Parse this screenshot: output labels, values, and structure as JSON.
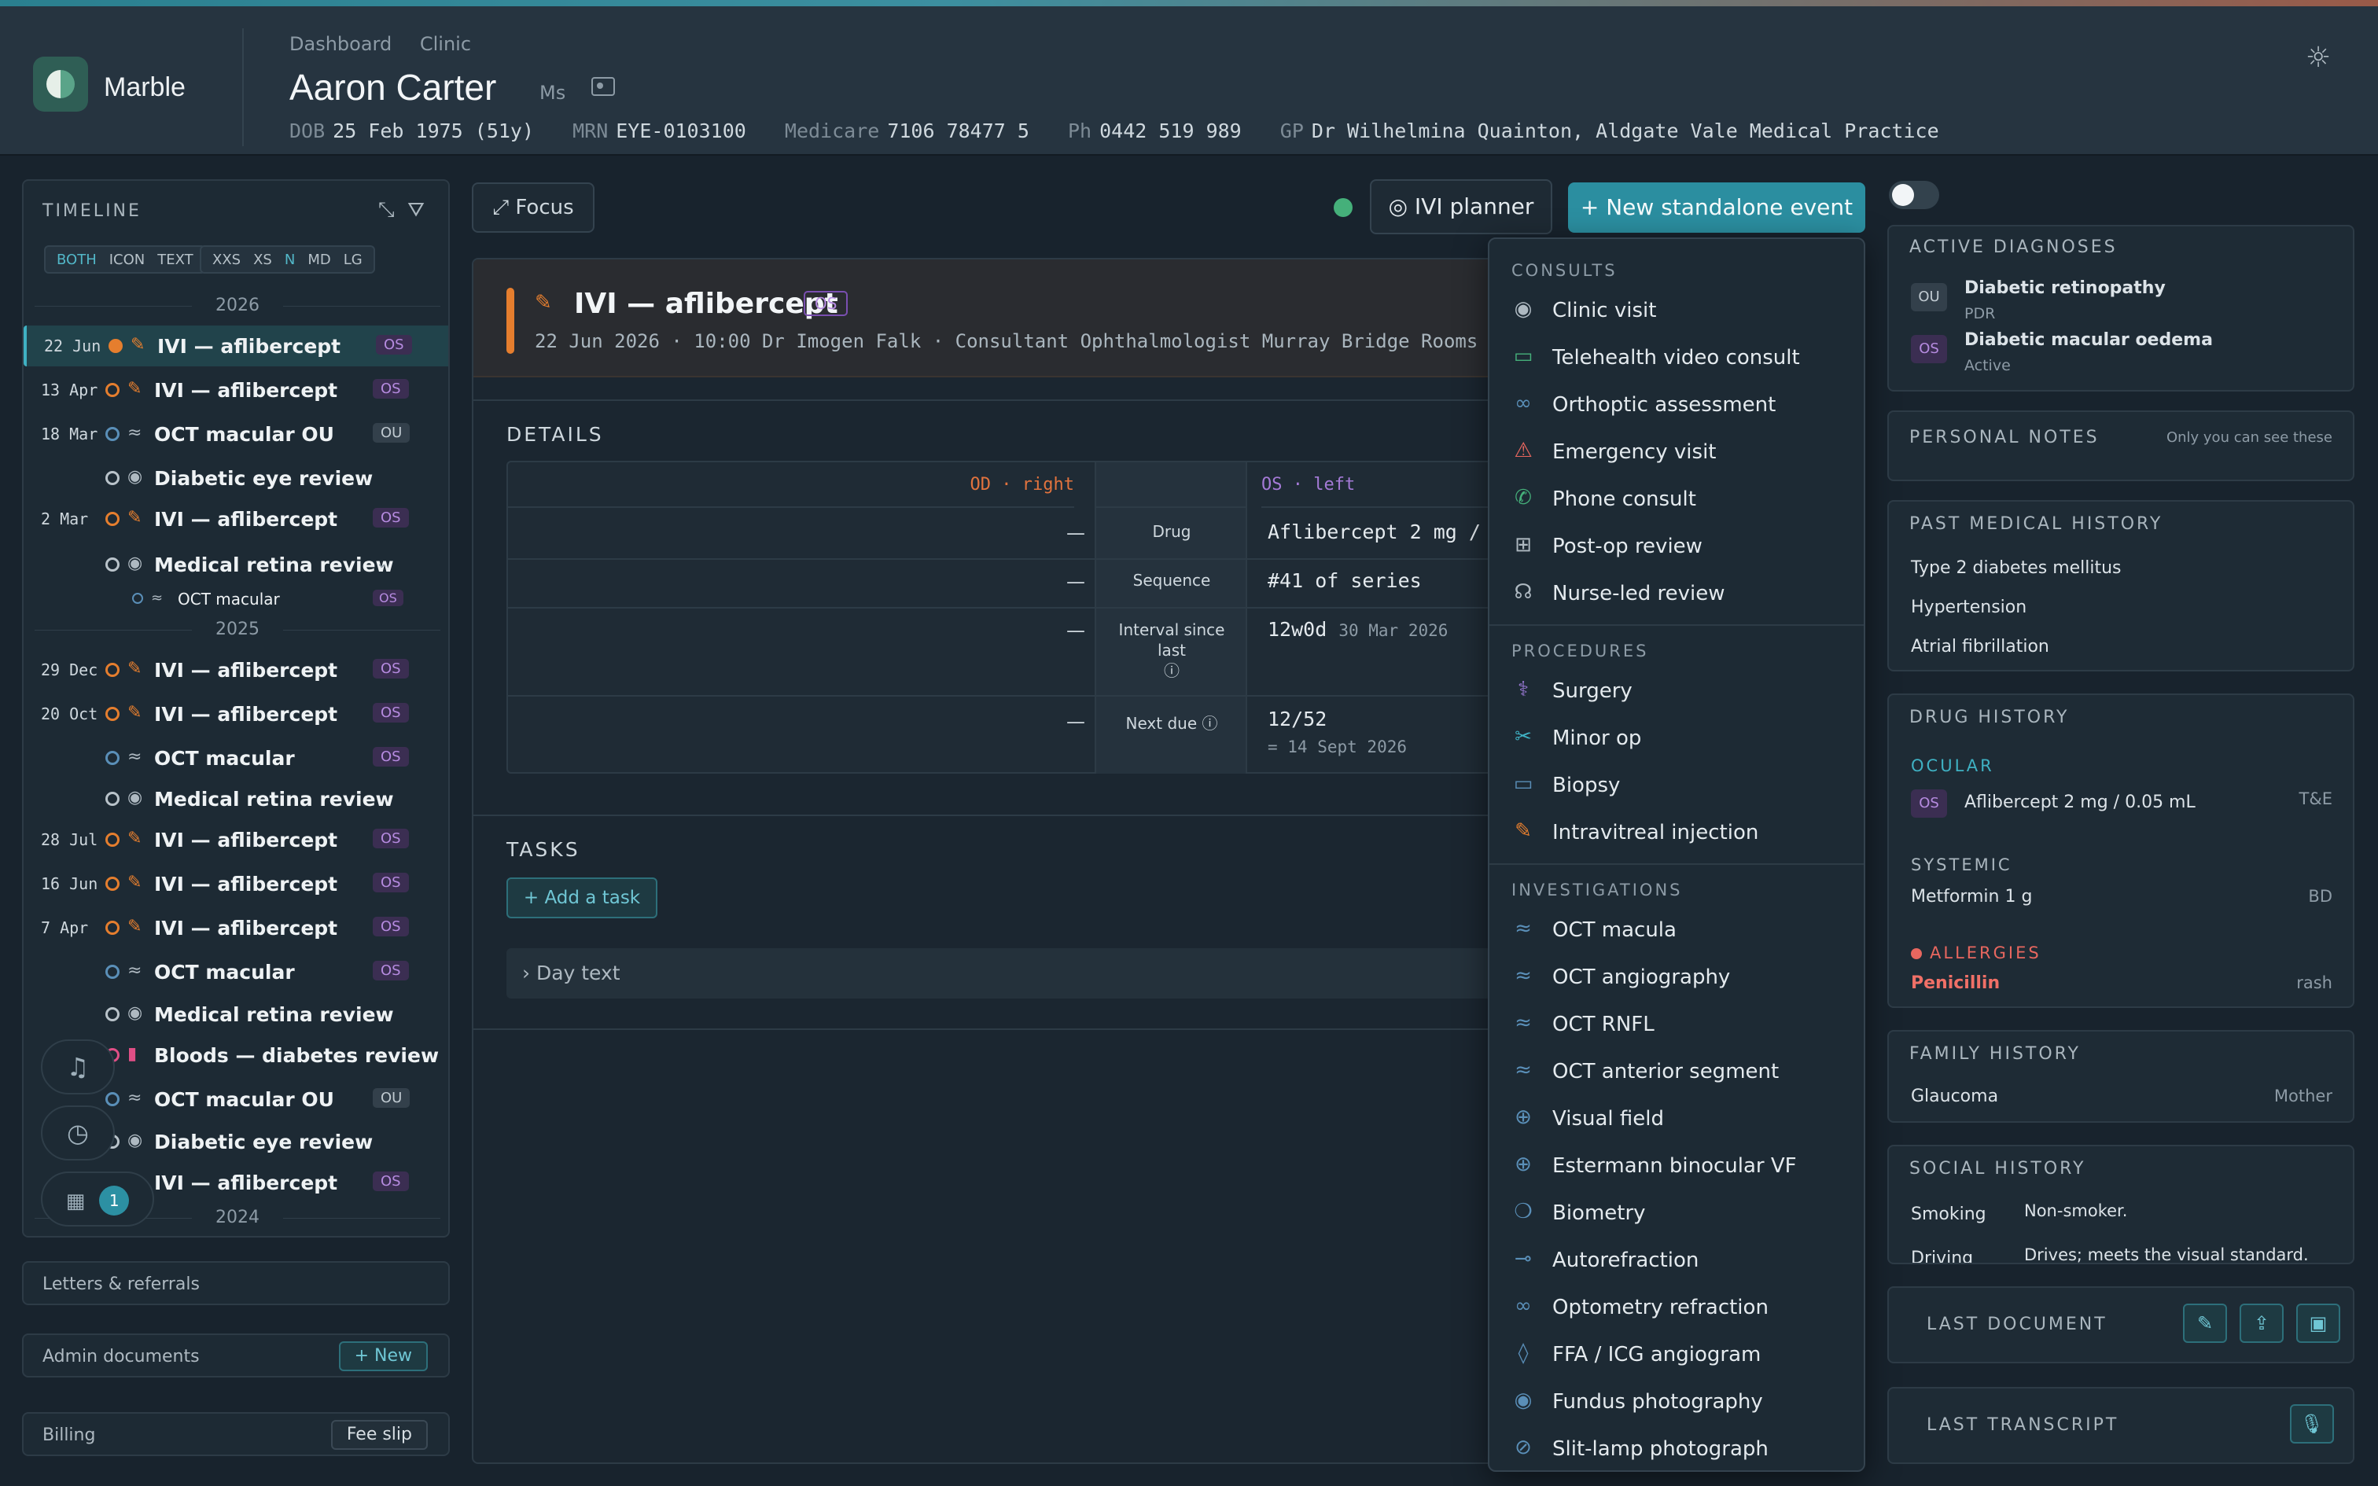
{
  "app": {
    "brand": "Marble"
  },
  "breadcrumb": [
    "Dashboard",
    "Clinic"
  ],
  "patient": {
    "name": "Aaron Carter",
    "title": "Ms",
    "dob_label": "DOB",
    "dob": "25 Feb 1975 (51y)",
    "mrn_label": "MRN",
    "mrn": "EYE-0103100",
    "medicare_label": "Medicare",
    "medicare": "7106 78477 5",
    "ph_label": "Ph",
    "ph": "0442 519 989",
    "gp_label": "GP",
    "gp": "Dr Wilhelmina Quainton, Aldgate Vale Medical Practice"
  },
  "timeline": {
    "title": "TIMELINE",
    "view_modes": [
      "BOTH",
      "ICON",
      "TEXT"
    ],
    "sizes": [
      "XXS",
      "XS",
      "N",
      "MD",
      "LG"
    ],
    "years": [
      "2026",
      "2025",
      "2024"
    ],
    "events": [
      {
        "date": "22 Jun",
        "title": "IVI — aflibercept",
        "tag": "OS"
      },
      {
        "date": "13 Apr",
        "title": "IVI — aflibercept",
        "tag": "OS"
      },
      {
        "date": "18 Mar",
        "title": "OCT macular OU",
        "tag": "OU"
      },
      {
        "date": "",
        "title": "Diabetic eye review",
        "tag": ""
      },
      {
        "date": "2 Mar",
        "title": "IVI — aflibercept",
        "tag": "OS"
      },
      {
        "date": "",
        "title": "Medical retina review",
        "tag": ""
      },
      {
        "date": "",
        "title": "OCT macular",
        "tag": "OS"
      },
      {
        "date": "29 Dec",
        "title": "IVI — aflibercept",
        "tag": "OS"
      },
      {
        "date": "20 Oct",
        "title": "IVI — aflibercept",
        "tag": "OS"
      },
      {
        "date": "",
        "title": "OCT macular",
        "tag": "OS"
      },
      {
        "date": "",
        "title": "Medical retina review",
        "tag": ""
      },
      {
        "date": "28 Jul",
        "title": "IVI — aflibercept",
        "tag": "OS"
      },
      {
        "date": "16 Jun",
        "title": "IVI — aflibercept",
        "tag": "OS"
      },
      {
        "date": "7 Apr",
        "title": "IVI — aflibercept",
        "tag": "OS"
      },
      {
        "date": "",
        "title": "OCT macular",
        "tag": "OS"
      },
      {
        "date": "",
        "title": "Medical retina review",
        "tag": ""
      },
      {
        "date": "",
        "title": "Bloods — diabetes review",
        "tag": ""
      },
      {
        "date": "",
        "title": "OCT macular OU",
        "tag": "OU"
      },
      {
        "date": "",
        "title": "Diabetic eye review",
        "tag": ""
      },
      {
        "date": "",
        "title": "IVI — aflibercept",
        "tag": "OS"
      }
    ],
    "notification_count": "1"
  },
  "left_panels": {
    "letters": "Letters & referrals",
    "admin": "Admin documents",
    "admin_btn": "+ New",
    "billing": "Billing",
    "billing_btn": "Fee slip"
  },
  "toolbar": {
    "focus": "⤢ Focus",
    "ivi_planner": "◎ IVI planner",
    "new_event": "+ New standalone event"
  },
  "event": {
    "title": "IVI — aflibercept",
    "tag": "OS",
    "subtitle": "22 Jun 2026 · 10:00   Dr Imogen Falk · Consultant Ophthalmologist   Murray Bridge Rooms",
    "details_label": "DETAILS",
    "od_header": "OD · right",
    "os_header": "OS · left",
    "rows": [
      {
        "label": "Drug",
        "od": "—",
        "os": "Aflibercept 2 mg /",
        "os_note": ""
      },
      {
        "label": "Sequence",
        "od": "—",
        "os": "#41 of series",
        "os_note": ""
      },
      {
        "label": "Interval since last",
        "od": "—",
        "os": "12w0d",
        "os_note": "30 Mar 2026"
      },
      {
        "label": "Next due",
        "od": "—",
        "os": "12/52",
        "os_note": "= 14 Sept 2026"
      }
    ],
    "tasks_label": "TASKS",
    "add_task": "+ Add a task",
    "day_text": "› Day text"
  },
  "menu": {
    "sections": [
      {
        "title": "CONSULTS",
        "items": [
          {
            "label": "Clinic visit",
            "icon": "eye-icon"
          },
          {
            "label": "Telehealth video consult",
            "icon": "video-icon"
          },
          {
            "label": "Orthoptic assessment",
            "icon": "glasses-icon"
          },
          {
            "label": "Emergency visit",
            "icon": "warning-icon"
          },
          {
            "label": "Phone consult",
            "icon": "phone-icon"
          },
          {
            "label": "Post-op review",
            "icon": "plus-square-icon"
          },
          {
            "label": "Nurse-led review",
            "icon": "stethoscope-icon"
          }
        ]
      },
      {
        "title": "PROCEDURES",
        "items": [
          {
            "label": "Surgery",
            "icon": "surgery-icon"
          },
          {
            "label": "Minor op",
            "icon": "scissors-icon"
          },
          {
            "label": "Biopsy",
            "icon": "biopsy-icon"
          },
          {
            "label": "Intravitreal injection",
            "icon": "syringe-icon"
          }
        ]
      },
      {
        "title": "INVESTIGATIONS",
        "items": [
          {
            "label": "OCT macula",
            "icon": "wave-icon"
          },
          {
            "label": "OCT angiography",
            "icon": "wave-icon"
          },
          {
            "label": "OCT RNFL",
            "icon": "wave-icon"
          },
          {
            "label": "OCT anterior segment",
            "icon": "wave-icon"
          },
          {
            "label": "Visual field",
            "icon": "crosshair-icon"
          },
          {
            "label": "Estermann binocular VF",
            "icon": "crosshair-icon"
          },
          {
            "label": "Biometry",
            "icon": "biometry-icon"
          },
          {
            "label": "Autorefraction",
            "icon": "autorefraction-icon"
          },
          {
            "label": "Optometry refraction",
            "icon": "glasses-icon"
          },
          {
            "label": "FFA / ICG angiogram",
            "icon": "drop-icon"
          },
          {
            "label": "Fundus photography",
            "icon": "eye-icon"
          },
          {
            "label": "Slit-lamp photograph",
            "icon": "eye-slash-icon"
          }
        ]
      }
    ]
  },
  "right": {
    "active_diagnoses": {
      "title": "ACTIVE DIAGNOSES",
      "items": [
        {
          "tag": "OU",
          "name": "Diabetic retinopathy",
          "sub": "PDR"
        },
        {
          "tag": "OS",
          "name": "Diabetic macular oedema",
          "sub": "Active"
        }
      ]
    },
    "personal_notes": {
      "title": "PERSONAL NOTES",
      "hint": "Only you can see these"
    },
    "pmh": {
      "title": "PAST MEDICAL HISTORY",
      "items": [
        "Type 2 diabetes mellitus",
        "Hypertension",
        "Atrial fibrillation"
      ]
    },
    "drug_history": {
      "title": "DRUG HISTORY",
      "ocular_label": "OCULAR",
      "ocular_tag": "OS",
      "ocular_drug": "Aflibercept 2 mg / 0.05 mL",
      "ocular_freq": "T&E",
      "systemic_label": "SYSTEMIC",
      "systemic_drug": "Metformin 1 g",
      "systemic_freq": "BD",
      "allergies_label": "ALLERGIES",
      "allergy": "Penicillin",
      "allergy_reaction": "rash"
    },
    "family_history": {
      "title": "FAMILY HISTORY",
      "condition": "Glaucoma",
      "relation": "Mother"
    },
    "social_history": {
      "title": "SOCIAL HISTORY",
      "rows": [
        {
          "k": "Smoking",
          "v": "Non-smoker."
        },
        {
          "k": "Driving",
          "v": "Drives; meets the visual standard."
        }
      ]
    },
    "last_document": "LAST DOCUMENT",
    "last_transcript": "LAST TRANSCRIPT"
  },
  "colors": {
    "accent": "#2b8ea0",
    "injection": "#e57e2e",
    "os_tag": "#b68be0",
    "allergy": "#e8675f"
  }
}
